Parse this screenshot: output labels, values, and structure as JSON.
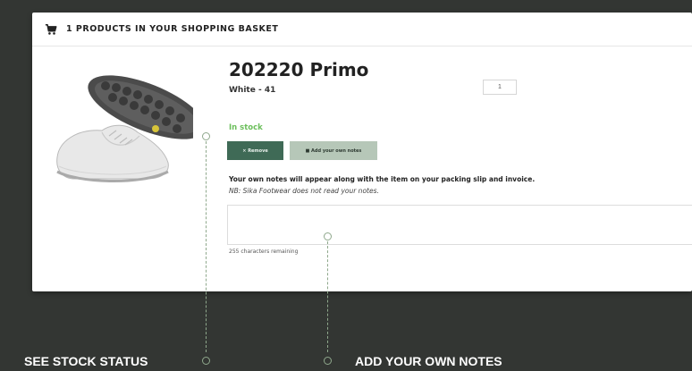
{
  "basket": {
    "header": "1 PRODUCTS IN YOUR SHOPPING BASKET",
    "cart_icon": "shopping-cart-icon"
  },
  "product": {
    "title": "202220 Primo",
    "variant": "White - 41",
    "quantity": "1",
    "stock_status": "In stock",
    "remove_label": "× Remove",
    "add_notes_label": "■ Add your own notes",
    "notes_info": "Your own notes will appear along with the item on your packing slip and invoice.",
    "notes_nb": "NB: Sika Footwear does not read your notes.",
    "notes_value": "",
    "chars_remaining": "255 characters remaining"
  },
  "callouts": {
    "stock": "SEE STOCK STATUS",
    "notes": "ADD YOUR OWN NOTES"
  },
  "colors": {
    "background": "#333633",
    "remove_button": "#3f6a56",
    "notes_button": "#b6c7b8",
    "stock_green": "#6cbf5c",
    "callout_accent": "#8fa88c"
  }
}
